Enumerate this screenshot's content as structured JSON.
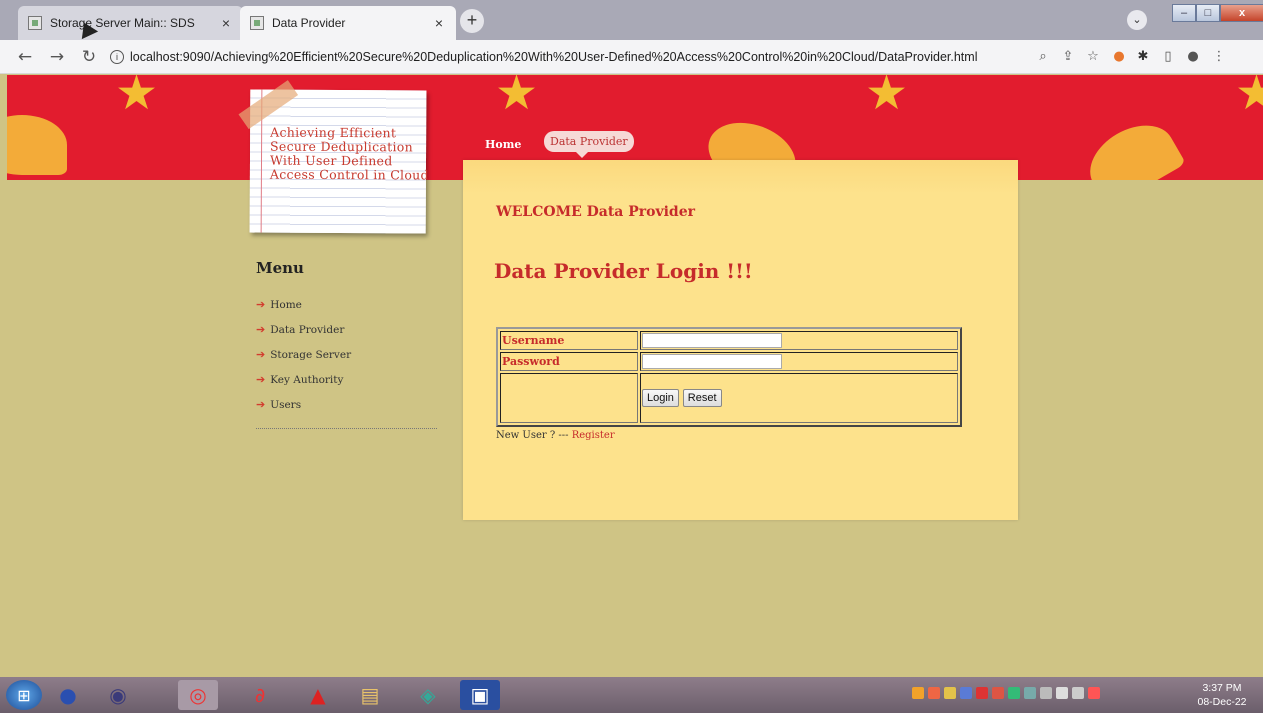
{
  "browser": {
    "tabs": [
      {
        "label": "Storage Server Main:: SDS",
        "close": "×"
      },
      {
        "label": "Data Provider",
        "close": "×"
      }
    ],
    "new_tab": "+",
    "tab_dropdown": "⌄",
    "window": {
      "minimize": "–",
      "maximize": "□",
      "close": "x"
    },
    "url_display": "localhost:9090/Achieving%20Efficient%20Secure%20Deduplication%20With%20User-Defined%20Access%20Control%20in%20Cloud/DataProvider.html",
    "info_icon": "i",
    "nav": {
      "back": "←",
      "forward": "→",
      "reload": "↻"
    },
    "toolbar_icons": {
      "zoom": "⌕",
      "share": "⇪",
      "bookmark": "☆",
      "extension": "✱",
      "sidepanel": "▯",
      "profile": "●",
      "menu": "⋮"
    }
  },
  "site": {
    "logo_title": "Achieving Efficient Secure Deduplication With User Defined Access Control in Cloud",
    "nav": {
      "home": "Home",
      "data_provider": "Data Provider"
    }
  },
  "sidebar": {
    "title": "Menu",
    "arrow": "➔",
    "items": [
      {
        "label": "Home"
      },
      {
        "label": "Data Provider"
      },
      {
        "label": "Storage Server"
      },
      {
        "label": "Key Authority"
      },
      {
        "label": "Users"
      }
    ]
  },
  "main": {
    "welcome": "WELCOME Data Provider",
    "heading": "Data Provider Login !!!",
    "form": {
      "username_label": "Username",
      "password_label": "Password",
      "username_value": "",
      "password_value": "",
      "login_button": "Login",
      "reset_button": "Reset"
    },
    "new_user_text": "New User ? --- ",
    "register_link": "Register"
  },
  "taskbar": {
    "apps": [
      "start",
      "ie",
      "eclipse",
      "chrome",
      "netbeans",
      "acrobat",
      "explorer",
      "network",
      "terminal"
    ],
    "clock_time": "3:37 PM",
    "clock_date": "08-Dec-22"
  },
  "colors": {
    "accent_red": "#c62b2b",
    "header_red": "#e21c2e",
    "page_bg": "#cfc485",
    "panel_bg": "#fde28c"
  }
}
